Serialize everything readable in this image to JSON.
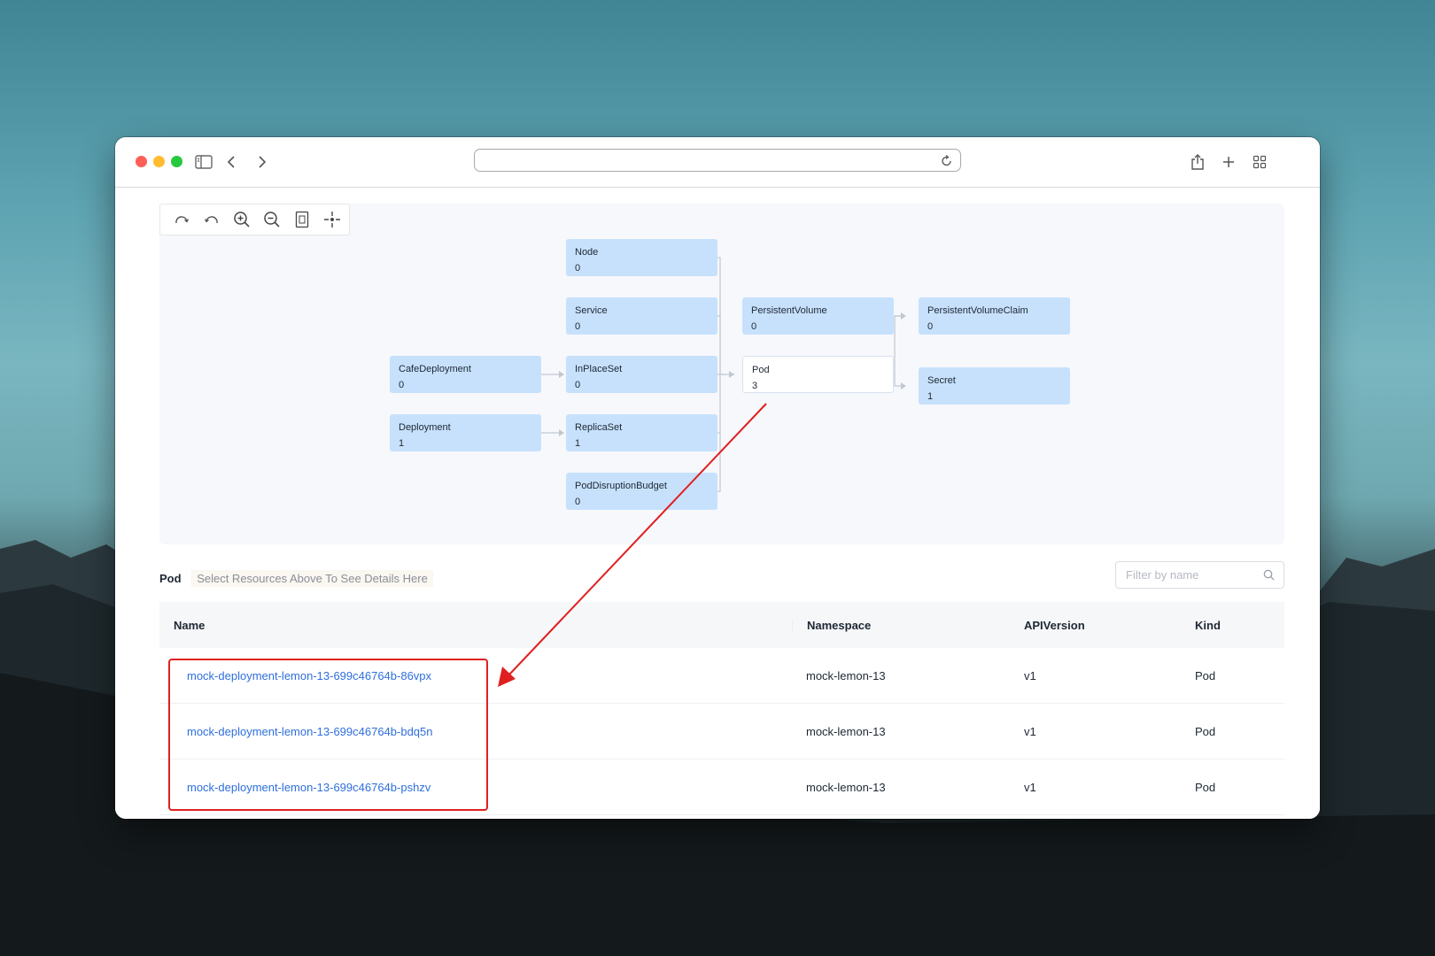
{
  "graph": {
    "tools": [
      "redo-icon",
      "undo-icon",
      "zoom-in-icon",
      "zoom-out-icon",
      "fit-page-icon",
      "center-icon"
    ],
    "nodes": {
      "node": {
        "label": "Node",
        "count": "0"
      },
      "service": {
        "label": "Service",
        "count": "0"
      },
      "cafedeployment": {
        "label": "CafeDeployment",
        "count": "0"
      },
      "inplaceset": {
        "label": "InPlaceSet",
        "count": "0"
      },
      "deployment": {
        "label": "Deployment",
        "count": "1"
      },
      "replicaset": {
        "label": "ReplicaSet",
        "count": "1"
      },
      "poddisruptionbudget": {
        "label": "PodDisruptionBudget",
        "count": "0"
      },
      "persistentvolume": {
        "label": "PersistentVolume",
        "count": "0"
      },
      "pod": {
        "label": "Pod",
        "count": "3"
      },
      "persistentvolumeclaim": {
        "label": "PersistentVolumeClaim",
        "count": "0"
      },
      "secret": {
        "label": "Secret",
        "count": "1"
      }
    }
  },
  "details": {
    "title": "Pod",
    "hint": "Select Resources Above To See Details Here",
    "filter_placeholder": "Filter by name"
  },
  "table": {
    "headers": {
      "name": "Name",
      "namespace": "Namespace",
      "apiversion": "APIVersion",
      "kind": "Kind"
    },
    "rows": [
      {
        "name": "mock-deployment-lemon-13-699c46764b-86vpx",
        "namespace": "mock-lemon-13",
        "apiversion": "v1",
        "kind": "Pod"
      },
      {
        "name": "mock-deployment-lemon-13-699c46764b-bdq5n",
        "namespace": "mock-lemon-13",
        "apiversion": "v1",
        "kind": "Pod"
      },
      {
        "name": "mock-deployment-lemon-13-699c46764b-pshzv",
        "namespace": "mock-lemon-13",
        "apiversion": "v1",
        "kind": "Pod"
      }
    ]
  },
  "colors": {
    "node_fill": "#c7e1fd",
    "link": "#2f6fdc",
    "annotation": "#e02020"
  }
}
